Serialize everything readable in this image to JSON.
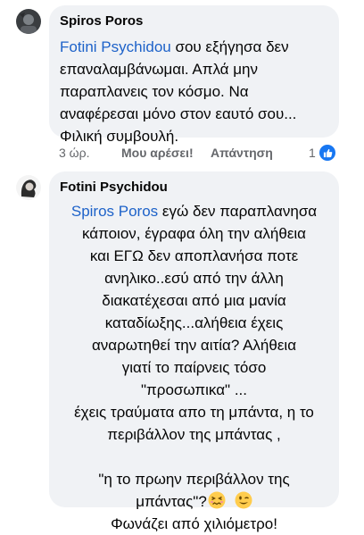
{
  "comments": [
    {
      "author": "Spiros Poros",
      "mention": "Fotini Psychidou",
      "text": " σου εξήγησα δεν επαναλαμβάνωμαι. Απλά μην παραπλανεις τον κόσμο. Να αναφέρεσαι μόνο στον εαυτό σου... Φιλική συμβουλή.",
      "time": "3 ώρ.",
      "like_label": "Μου αρέσει!",
      "reply_label": "Απάντηση",
      "reaction_count": "1"
    },
    {
      "author": "Fotini Psychidou",
      "mention": "Spiros Poros",
      "lines": [
        " εγώ δεν  παραπλανησα",
        "κάποιον, έγραφα όλη την αλήθεια",
        "και ΕΓΩ δεν αποπλανήσα ποτε",
        "ανηλικο..εσύ από την άλλη",
        "διακατέχεσαι από μια μανία",
        "καταδίωξης...αλήθεια έχεις",
        "αναρωτηθεί την αιτία? Αλήθεια",
        "γιατί το παίρνεις τόσο",
        "\"προσωπικα\" ...",
        "έχεις τραύματα απο τη μπάντα, η το",
        "περιβάλλον της μπάντας ,",
        "",
        "\"η το πρωην περιβάλλον της",
        "μπάντας\"?",
        "Φωνάζει από χιλιόμετρο!"
      ],
      "emojis": [
        "confounded-face",
        "winking-face"
      ]
    }
  ],
  "colors": {
    "bubble": "#f0f2f5",
    "mention": "#1d62c9",
    "meta": "#65676b",
    "like_blue": "#1877f2"
  }
}
